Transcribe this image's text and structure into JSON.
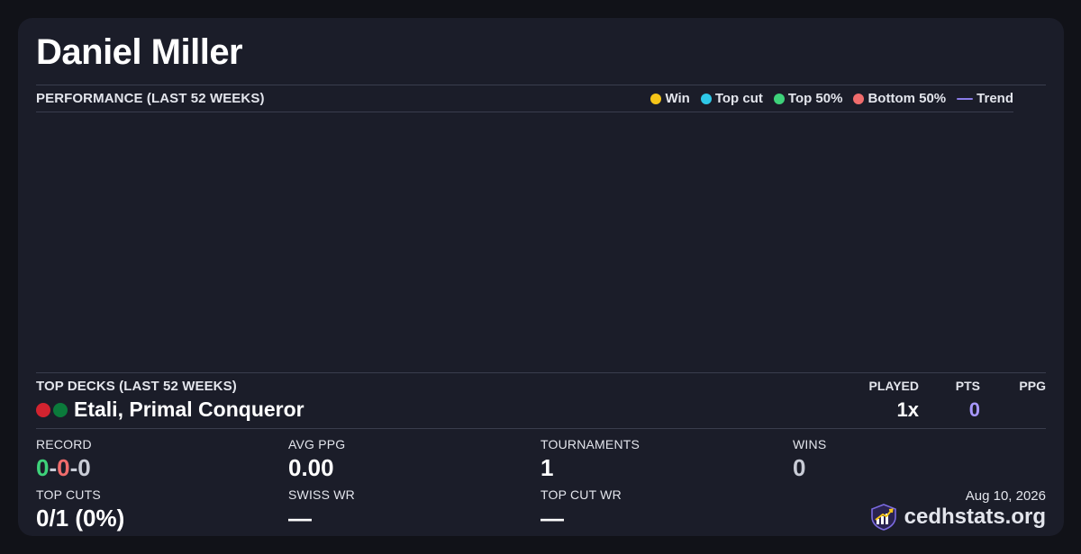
{
  "player": {
    "name": "Daniel Miller"
  },
  "performance": {
    "title": "PERFORMANCE (LAST 52 WEEKS)",
    "legend": [
      {
        "label": "Win",
        "color": "#f5c518",
        "kind": "dot"
      },
      {
        "label": "Top cut",
        "color": "#2ec8e8",
        "kind": "dot"
      },
      {
        "label": "Top 50%",
        "color": "#3ed27a",
        "kind": "dot"
      },
      {
        "label": "Bottom 50%",
        "color": "#f06c6c",
        "kind": "dot"
      },
      {
        "label": "Trend",
        "color": "#8a7ce8",
        "kind": "line"
      }
    ]
  },
  "chart_data": {
    "type": "scatter",
    "title": "PERFORMANCE (LAST 52 WEEKS)",
    "series": [
      {
        "name": "Win",
        "values": []
      },
      {
        "name": "Top cut",
        "values": []
      },
      {
        "name": "Top 50%",
        "values": []
      },
      {
        "name": "Bottom 50%",
        "values": []
      },
      {
        "name": "Trend",
        "values": []
      }
    ]
  },
  "top_decks": {
    "title": "TOP DECKS (LAST 52 WEEKS)",
    "headers": {
      "played": "PLAYED",
      "pts": "PTS",
      "ppg": "PPG"
    },
    "decks": [
      {
        "name": "Etali, Primal Conqueror",
        "colors": [
          "#d2232f",
          "#0b7a3b"
        ],
        "played": "1x",
        "pts": "0",
        "ppg": ""
      }
    ]
  },
  "stats": {
    "record": {
      "label": "RECORD",
      "wins": "0",
      "losses": "0",
      "draws": "0",
      "sep": "-"
    },
    "avg_ppg": {
      "label": "AVG PPG",
      "value": "0.00"
    },
    "tournaments": {
      "label": "TOURNAMENTS",
      "value": "1"
    },
    "wins": {
      "label": "WINS",
      "value": "0"
    },
    "top_cuts": {
      "label": "TOP CUTS",
      "value": "0/1 (0%)"
    },
    "swiss_wr": {
      "label": "SWISS WR",
      "value": "—"
    },
    "top_cut_wr": {
      "label": "TOP CUT WR",
      "value": "—"
    }
  },
  "footer": {
    "date": "Aug 10, 2026",
    "brand": "cedhstats.org",
    "brand_icon": "chart-shield-icon"
  },
  "colors": {
    "win_green": "#3ed27a",
    "loss_red": "#f06c6c",
    "draw_gray": "#c9ccd6",
    "pts_purple": "#a898ff",
    "val_gray": "#c9ccd6"
  }
}
